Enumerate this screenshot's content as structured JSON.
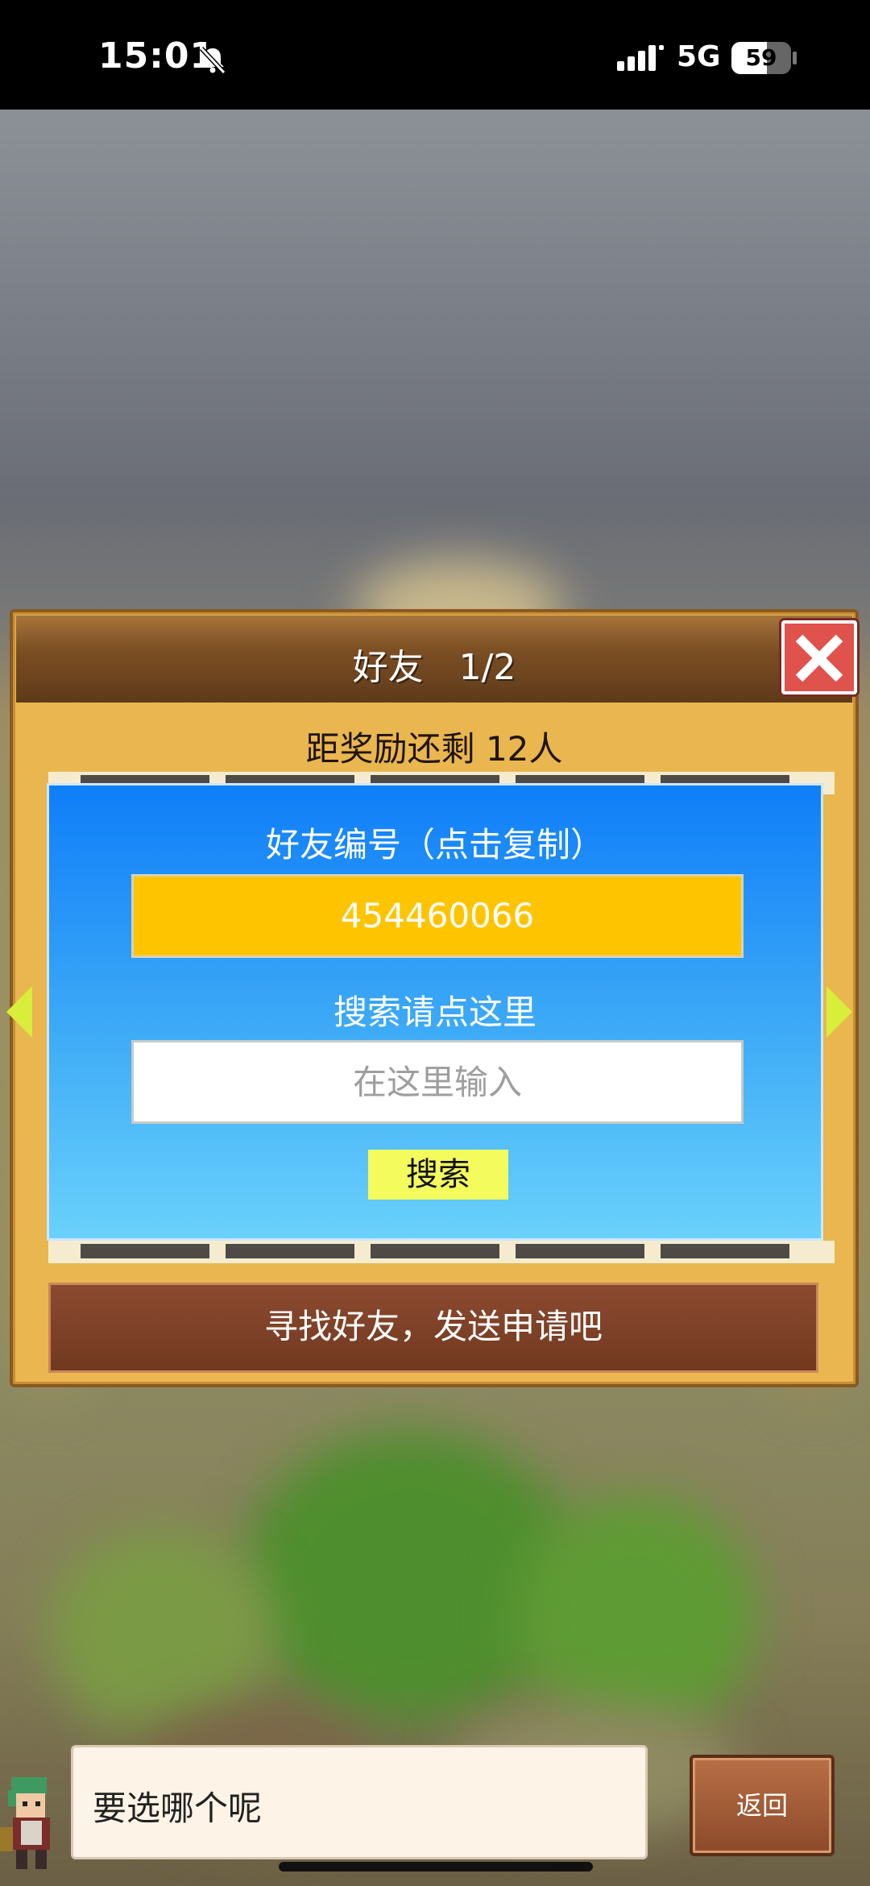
{
  "status_bar": {
    "time": "15:01",
    "network": "5G",
    "battery_level": "59",
    "battery_fraction": 0.59,
    "icons": [
      "bell-muted-icon",
      "signal-icon",
      "battery-icon"
    ]
  },
  "friends_panel": {
    "title": "好友　1/2",
    "reward_remaining": "距奖励还剩 12人",
    "close_icon": "close-icon",
    "arrows": [
      "left-arrow-icon",
      "right-arrow-icon"
    ],
    "search_dialog": {
      "friend_id_label": "好友编号（点击复制）",
      "friend_id": "454460066",
      "search_label": "搜索请点这里",
      "search_placeholder": "在这里输入",
      "search_button": "搜索"
    },
    "find_friends_text": "寻找好友，发送申请吧"
  },
  "bottom_dialog": {
    "message": "要选哪个呢",
    "back_button": "返回"
  },
  "colors": {
    "panel_wood": "#e9b64f",
    "dialog_blue_top": "#0f7ef8",
    "dialog_blue_bottom": "#6ad1fb",
    "id_box_yellow": "#ffc400",
    "search_button_yellow": "#f3fc5c",
    "close_button_red": "#e0524c",
    "find_friends_brown": "#7d3f24"
  }
}
